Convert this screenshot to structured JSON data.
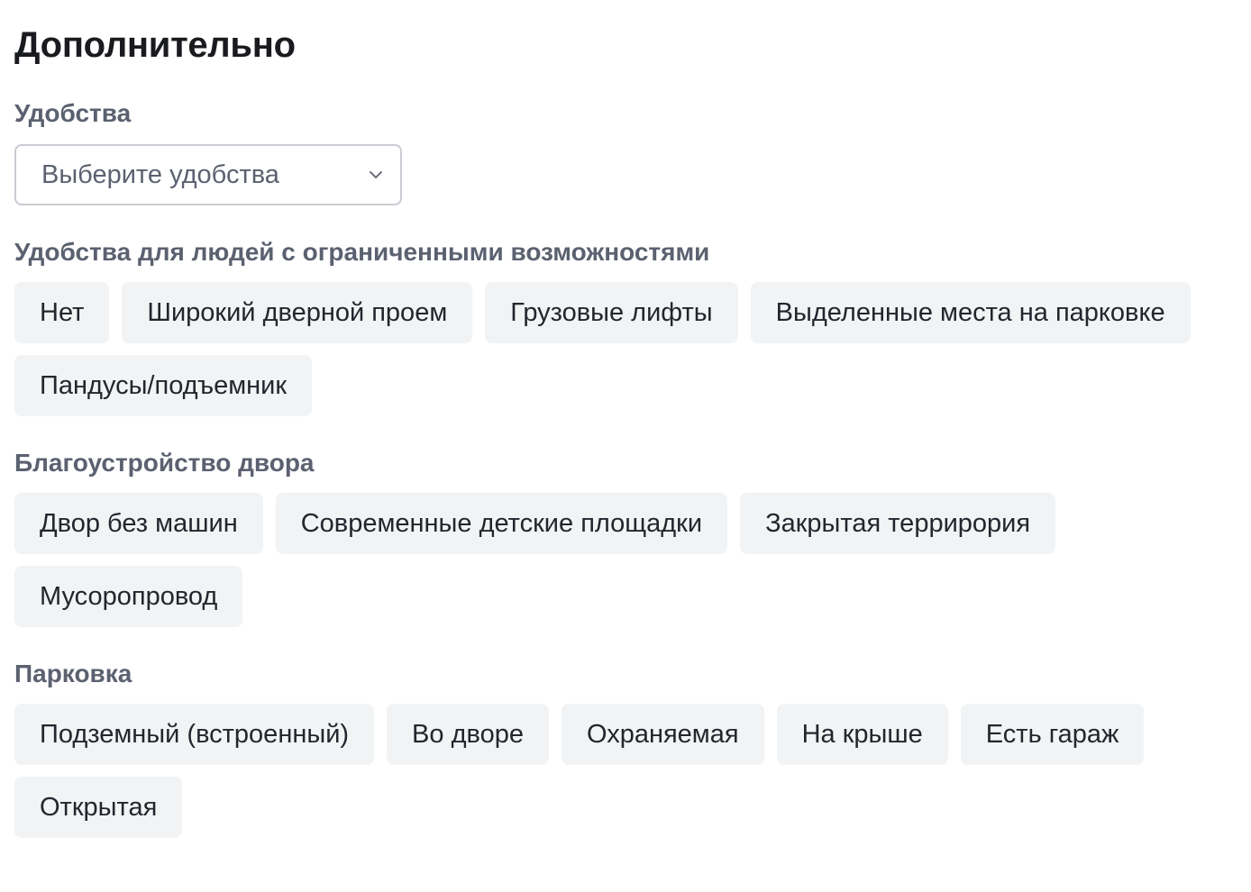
{
  "page_title": "Дополнительно",
  "amenities": {
    "label": "Удобства",
    "select_placeholder": "Выберите удобства",
    "chevron_icon": "chevron-down-icon"
  },
  "accessibility": {
    "label": "Удобства для людей с ограниченными возможностями",
    "options": [
      "Нет",
      "Широкий дверной проем",
      "Грузовые лифты",
      "Выделенные места на парковке",
      "Пандусы/подъемник"
    ]
  },
  "yard": {
    "label": "Благоустройство двора",
    "options": [
      "Двор без машин",
      "Современные детские площадки",
      "Закрытая террирория",
      "Мусоропровод"
    ]
  },
  "parking": {
    "label": "Парковка",
    "options": [
      "Подземный (встроенный)",
      "Во дворе",
      "Охраняемая",
      "На крыше",
      "Есть гараж",
      "Открытая"
    ]
  },
  "colors": {
    "chip_bg": "#f1f3f5",
    "label": "#5b6170",
    "border": "#c9ccd2"
  }
}
